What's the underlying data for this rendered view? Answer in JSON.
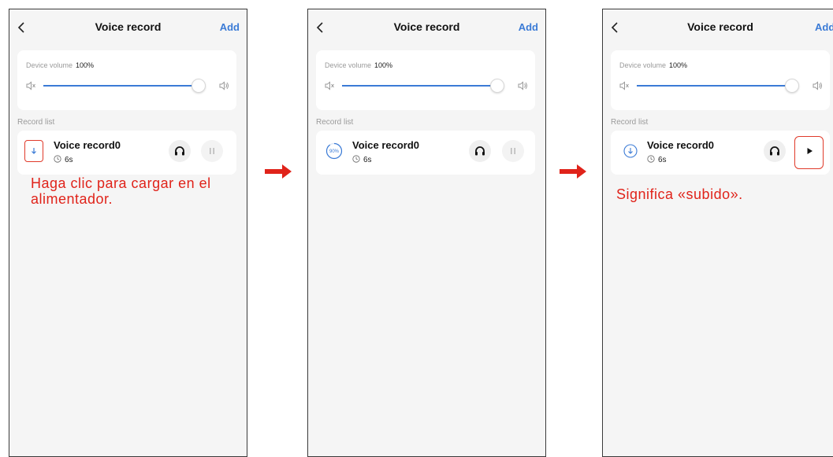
{
  "screens": [
    {
      "header": {
        "title": "Voice record",
        "add_label": "Add"
      },
      "volume": {
        "label": "Device volume",
        "value": "100%"
      },
      "record_list_label": "Record list",
      "record": {
        "name": "Voice record0",
        "duration": "6s",
        "status_icon": "download-icon",
        "action_icon": "pause-icon"
      },
      "annotation": "Haga clic para cargar en el alimentador."
    },
    {
      "header": {
        "title": "Voice record",
        "add_label": "Add"
      },
      "volume": {
        "label": "Device volume",
        "value": "100%"
      },
      "record_list_label": "Record list",
      "record": {
        "name": "Voice record0",
        "duration": "6s",
        "status_icon": "upload-progress-icon",
        "progress_text": "90%",
        "progress": 0.9,
        "action_icon": "pause-icon"
      }
    },
    {
      "header": {
        "title": "Voice record",
        "add_label": "Add"
      },
      "volume": {
        "label": "Device volume",
        "value": "100%"
      },
      "record_list_label": "Record list",
      "record": {
        "name": "Voice record0",
        "duration": "6s",
        "status_icon": "download-icon",
        "action_icon": "play-icon"
      },
      "annotation": "Significa «subido»."
    }
  ],
  "volume_level": 1.0,
  "colors": {
    "accent": "#3b7bd6",
    "annotation": "#e0231a",
    "background": "#f5f5f5",
    "card": "#ffffff"
  }
}
